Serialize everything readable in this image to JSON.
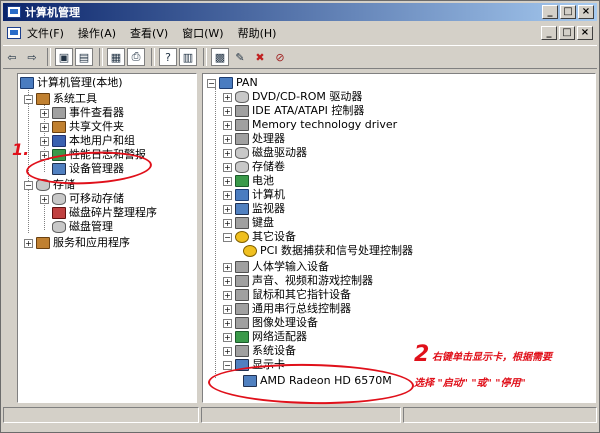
{
  "window": {
    "title": "计算机管理"
  },
  "titlebar_buttons": [
    "_",
    "□",
    "×"
  ],
  "menu": [
    "文件(F)",
    "操作(A)",
    "查看(V)",
    "窗口(W)",
    "帮助(H)"
  ],
  "child_buttons": [
    "_",
    "□",
    "×"
  ],
  "left_tree": [
    "计算机管理(本地)",
    "系统工具",
    "事件查看器",
    "共享文件夹",
    "本地用户和组",
    "性能日志和警报",
    "设备管理器",
    "存储",
    "可移动存储",
    "磁盘碎片整理程序",
    "磁盘管理",
    "服务和应用程序"
  ],
  "right_tree": [
    "PAN",
    "DVD/CD-ROM 驱动器",
    "IDE ATA/ATAPI 控制器",
    "Memory technology driver",
    "处理器",
    "磁盘驱动器",
    "存储卷",
    "电池",
    "计算机",
    "监视器",
    "键盘",
    "其它设备",
    "PCI 数据捕获和信号处理控制器",
    "人体学输入设备",
    "声音、视频和游戏控制器",
    "鼠标和其它指针设备",
    "通用串行总线控制器",
    "图像处理设备",
    "网络适配器",
    "系统设备",
    "显示卡",
    "AMD Radeon HD 6570M"
  ],
  "annotations": {
    "num1": "1.",
    "num2": "2",
    "text2_line1": "右键单击显示卡，根据需要",
    "text2_line2": "选择 \"启动\" \"或\" \"停用\""
  },
  "colors": {
    "annotation": "#e0101a",
    "titlebar": "#0a246a"
  }
}
